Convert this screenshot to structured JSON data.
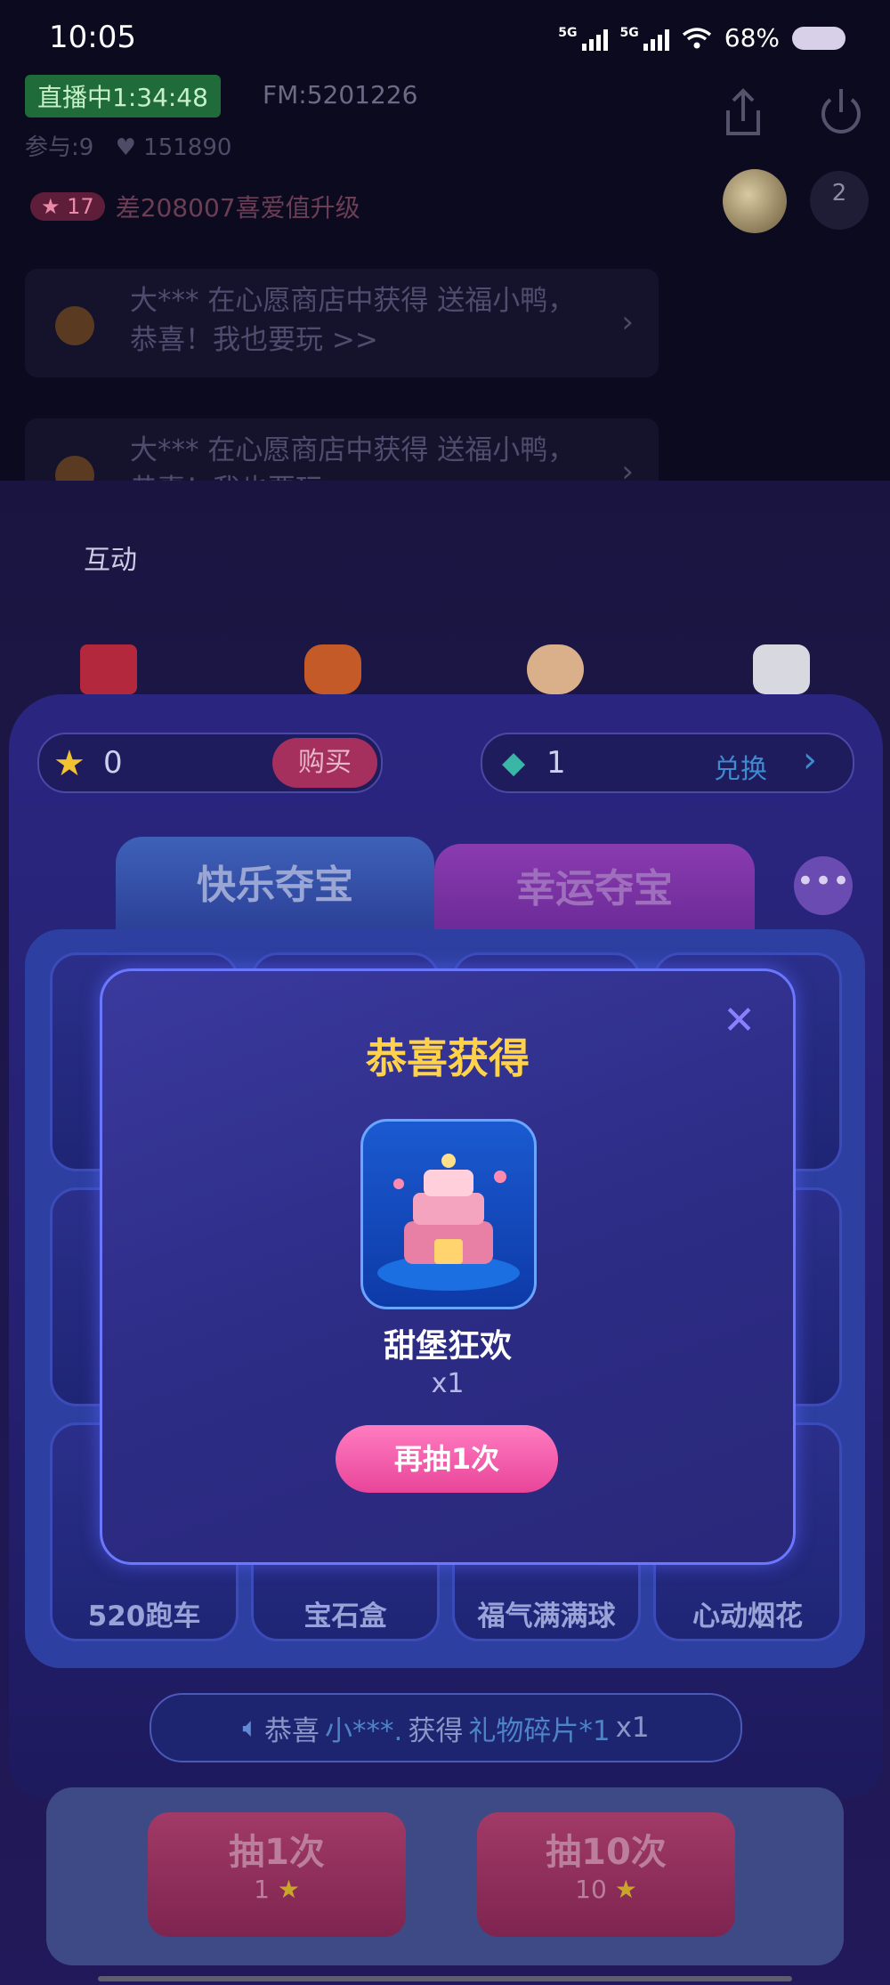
{
  "status_bar": {
    "time": "10:05",
    "signal1": "5G",
    "signal2": "5G",
    "battery": "68%"
  },
  "live": {
    "badge": "直播中1:34:48",
    "fm": "FM:5201226",
    "participants": "参与:9",
    "likes": "151890",
    "level": "17",
    "upgrade_text": "差208007喜爱值升级",
    "online_count": "2"
  },
  "notices": [
    {
      "text": "大*** 在心愿商店中获得 送福小鸭，恭喜！我也要玩 >>"
    },
    {
      "text": "大*** 在心愿商店中获得 送福小鸭，恭喜！我也要玩 >>"
    }
  ],
  "interaction_label": "互动",
  "wallet": {
    "coins": "0",
    "buy_label": "购买",
    "gems": "1",
    "exchange_label": "兑换"
  },
  "tabs": [
    {
      "label": "快乐夺宝"
    },
    {
      "label": "幸运夺宝"
    }
  ],
  "more_label": "•••",
  "grid": {
    "bottom_row": [
      "520跑车",
      "宝石盒",
      "福气满满球",
      "心动烟花"
    ]
  },
  "ticker": {
    "prefix": "恭喜",
    "user": "小***.",
    "action": "获得",
    "item": "礼物碎片*1",
    "qty": "x1"
  },
  "draw_buttons": [
    {
      "label": "抽1次",
      "cost": "1"
    },
    {
      "label": "抽10次",
      "cost": "10"
    }
  ],
  "modal": {
    "title": "恭喜获得",
    "prize_name": "甜堡狂欢",
    "prize_qty": "x1",
    "again_label": "再抽1次",
    "close": "✕"
  },
  "colors": {
    "accent_yellow": "#ffd24a",
    "accent_pink": "#e9459a",
    "panel": "#2a2680"
  }
}
